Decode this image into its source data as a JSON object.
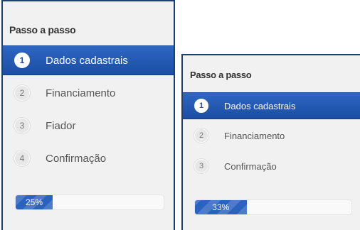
{
  "panels": [
    {
      "title": "Passo a passo",
      "active_step": 1,
      "steps": [
        {
          "number": "1",
          "label": "Dados cadastrais"
        },
        {
          "number": "2",
          "label": "Financiamento"
        },
        {
          "number": "3",
          "label": "Fiador"
        },
        {
          "number": "4",
          "label": "Confirmação"
        }
      ],
      "progress": {
        "percent": 25,
        "label": "25%"
      }
    },
    {
      "title": "Passo a passo",
      "active_step": 1,
      "steps": [
        {
          "number": "1",
          "label": "Dados cadastrais"
        },
        {
          "number": "2",
          "label": "Financiamento"
        },
        {
          "number": "3",
          "label": "Confirmação"
        }
      ],
      "progress": {
        "percent": 33,
        "label": "33%"
      }
    }
  ],
  "colors": {
    "accent": "#1b4ea5",
    "panel_bg": "#f1f1f1",
    "border": "#1b3f73"
  }
}
